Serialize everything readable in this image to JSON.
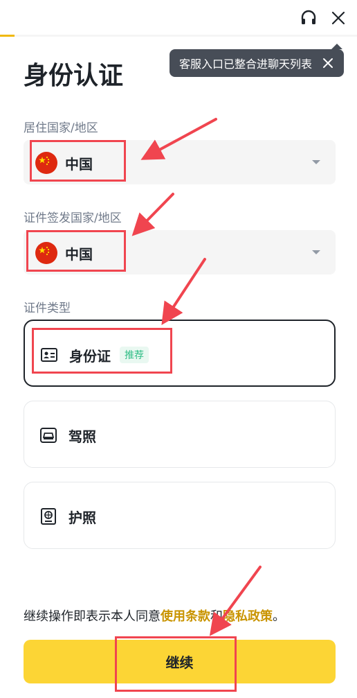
{
  "header": {
    "progress_fraction": 0.04,
    "headset_icon": "headset-icon",
    "close_icon": "close-icon"
  },
  "tooltip": {
    "text": "客服入口已整合进聊天列表",
    "close_icon": "close-icon"
  },
  "page": {
    "title": "身份认证"
  },
  "residence": {
    "label": "居住国家/地区",
    "value": "中国",
    "flag_icon": "china-flag-icon"
  },
  "issuing": {
    "label": "证件签发国家/地区",
    "value": "中国",
    "flag_icon": "china-flag-icon"
  },
  "doc_type": {
    "label": "证件类型",
    "options": [
      {
        "label": "身份证",
        "badge": "推荐",
        "icon": "id-card-icon",
        "selected": true
      },
      {
        "label": "驾照",
        "icon": "driver-license-icon",
        "selected": false
      },
      {
        "label": "护照",
        "icon": "passport-icon",
        "selected": false
      }
    ]
  },
  "consent": {
    "prefix": "继续操作即表示本人同意",
    "terms_link": "使用条款",
    "and": "和",
    "privacy_link": "隐私政策",
    "suffix": "。"
  },
  "continue_button": {
    "label": "继续"
  },
  "colors": {
    "accent_yellow": "#fcd535",
    "link_gold": "#c99400",
    "badge_green": "#2ebd85",
    "annotation_red": "#f0454f"
  }
}
